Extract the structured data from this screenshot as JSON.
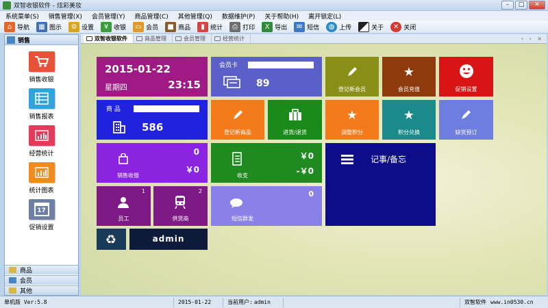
{
  "window": {
    "title": "双智收银软件 - 炫彩美妆",
    "min_label": "–",
    "max_label": "□",
    "close_label": "✕"
  },
  "menu": [
    "系统菜单(S)",
    "销售管理(X)",
    "会员管理(Y)",
    "商品管理(C)",
    "其他管理(Q)",
    "数据维护(P)",
    "关于帮助(H)",
    "离开锁定(L)"
  ],
  "toolbar": [
    {
      "label": "导航",
      "icon": "home-icon",
      "color": "#e0672e"
    },
    {
      "label": "图示",
      "icon": "grid-icon",
      "color": "#3f6fb6"
    },
    {
      "label": "设置",
      "icon": "gear-icon",
      "color": "#d9a51e"
    },
    {
      "label": "收银",
      "icon": "yen-icon",
      "color": "#3c9b3c"
    },
    {
      "label": "会员",
      "icon": "card-icon",
      "color": "#e09a2b"
    },
    {
      "label": "商品",
      "icon": "box-icon",
      "color": "#8a5a2c"
    },
    {
      "label": "统计",
      "icon": "chart-icon",
      "color": "#d64545"
    },
    {
      "label": "打印",
      "icon": "printer-icon",
      "color": "#6d6d6d"
    },
    {
      "label": "导出",
      "icon": "excel-icon",
      "color": "#2f8a3a"
    },
    {
      "label": "短信",
      "icon": "sms-icon",
      "color": "#3b79c4"
    },
    {
      "label": "上传",
      "icon": "globe-icon",
      "color": "#2a8ac8"
    },
    {
      "label": "关于",
      "icon": "about-icon",
      "color": "#222222"
    },
    {
      "label": "关闭",
      "icon": "close-icon",
      "color": "#d63a2f"
    }
  ],
  "left_panel": {
    "header": "销售",
    "items": [
      {
        "label": "销售收银",
        "icon": "cart-icon",
        "color": "#e8523b"
      },
      {
        "label": "销售报表",
        "icon": "list-icon",
        "color": "#2fa3dc"
      },
      {
        "label": "经营统计",
        "icon": "bar-chart-icon",
        "color": "#e33b5c"
      },
      {
        "label": "统计图表",
        "icon": "bar-chart-icon",
        "color": "#f08c1e"
      },
      {
        "label": "促销设置",
        "icon": "calendar-icon",
        "color": "#6e7fa6"
      }
    ],
    "calendar_day": "17",
    "footers": [
      {
        "label": "商品",
        "color": "#d9b84b"
      },
      {
        "label": "会员",
        "color": "#4b86c4"
      },
      {
        "label": "其他",
        "color": "#d9b84b"
      }
    ]
  },
  "tabs": [
    "双智收银软件",
    "商品管理",
    "会员管理",
    "经营统计"
  ],
  "tab_arrows": "‹ › ×",
  "tiles": {
    "date": {
      "date": "2015-01-22",
      "weekday": "星期四",
      "time": "23:15",
      "color": "#a01a86"
    },
    "member_card": {
      "label": "会员卡",
      "count": "89",
      "color": "#5b5fc8"
    },
    "product": {
      "label": "商 品",
      "count": "586",
      "color": "#1f23e0"
    },
    "sales": {
      "label": "销售收银",
      "count": "0",
      "amount": "￥0",
      "color": "#8a24e0"
    },
    "income": {
      "label": "收支",
      "income": "￥0",
      "expense": "-￥0",
      "color": "#1f8a1f"
    },
    "staff": {
      "label": "员工",
      "count": "1",
      "color": "#7e1a86"
    },
    "supplier": {
      "label": "供货商",
      "count": "2",
      "color": "#7e1a86"
    },
    "sms": {
      "label": "短信群发",
      "count": "0",
      "color": "#8b7fe8"
    },
    "register_member": {
      "label": "登记新会员",
      "color": "#8a8f18"
    },
    "member_recharge": {
      "label": "会员充值",
      "color": "#8f3a0d"
    },
    "promotion": {
      "label": "促销设置",
      "color": "#d81414"
    },
    "register_product": {
      "label": "登记新商品",
      "color": "#f57a1a"
    },
    "purchase": {
      "label": "进货/退货",
      "color": "#1a8a1a"
    },
    "adjust_points": {
      "label": "调整积分",
      "color": "#f57a1a"
    },
    "points_exchange": {
      "label": "积分兑换",
      "color": "#1a8a8a"
    },
    "quick_order": {
      "label": "缺货预订",
      "color": "#6d7de0"
    },
    "notes": {
      "label": "记事/备忘",
      "color": "#0d0d8a"
    },
    "recycle": {
      "color": "#1a3a5a"
    },
    "user": {
      "label": "admin",
      "color": "#0d1a3a"
    }
  },
  "status": {
    "version": "单机版 Ver:5.8",
    "date": "2015-01-22",
    "user_label": "当前用户:",
    "user": "admin",
    "company": "双智软件",
    "site": "www.in0530.cn"
  }
}
